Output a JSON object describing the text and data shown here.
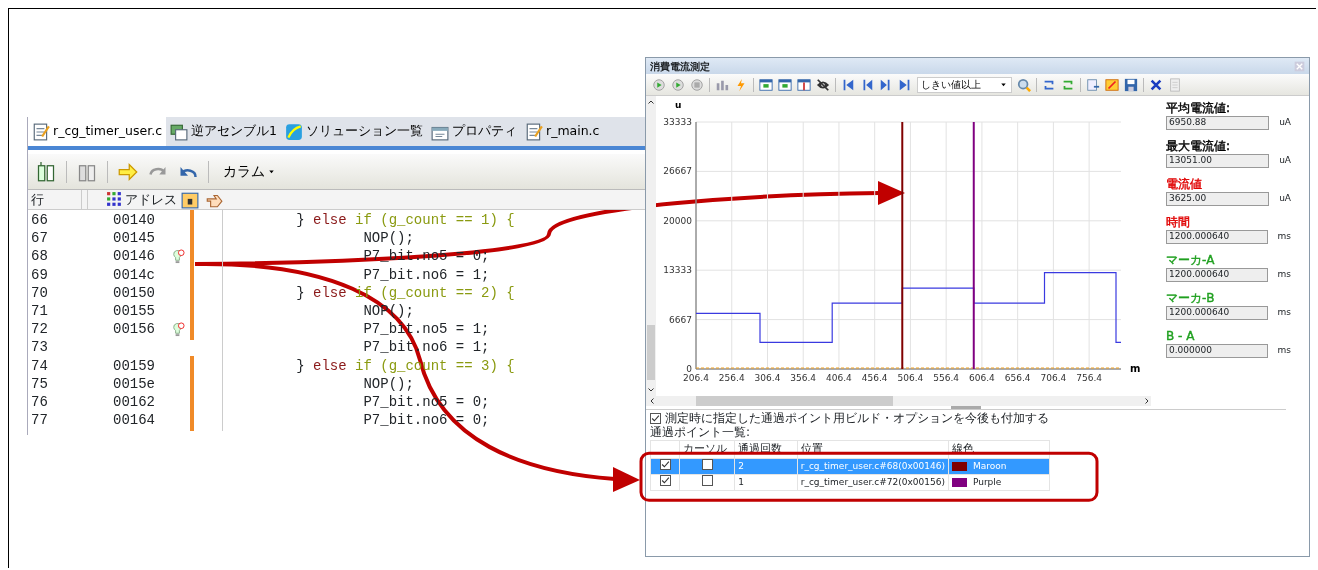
{
  "editor": {
    "tabs": [
      {
        "label": "r_cg_timer_user.c",
        "kind": "source",
        "selected": true
      },
      {
        "label": "逆アセンブル1",
        "kind": "disassembly",
        "selected": false
      },
      {
        "label": "ソリューション一覧",
        "kind": "solution",
        "selected": false
      },
      {
        "label": "プロパティ",
        "kind": "property",
        "selected": false
      },
      {
        "label": "r_main.c",
        "kind": "source",
        "selected": false
      }
    ],
    "column_menu": "カラム",
    "headers": [
      "行",
      "アドレス"
    ],
    "rows": [
      {
        "line": "66",
        "address": "00140",
        "passpoint": false,
        "executed": true,
        "code": [
          {
            "text": "        } ",
            "kind": "plain"
          },
          {
            "text": "else",
            "kind": "keyword"
          },
          {
            "text": " if (g_count == 1) {",
            "kind": "condition"
          }
        ]
      },
      {
        "line": "67",
        "address": "00145",
        "passpoint": false,
        "executed": true,
        "code": [
          {
            "text": "                NOP();",
            "kind": "plain"
          }
        ]
      },
      {
        "line": "68",
        "address": "00146",
        "passpoint": true,
        "executed": true,
        "code": [
          {
            "text": "                P7_bit.no5 = 0;",
            "kind": "plain"
          }
        ]
      },
      {
        "line": "69",
        "address": "0014c",
        "passpoint": false,
        "executed": true,
        "code": [
          {
            "text": "                P7_bit.no6 = 1;",
            "kind": "plain"
          }
        ]
      },
      {
        "line": "70",
        "address": "00150",
        "passpoint": false,
        "executed": true,
        "code": [
          {
            "text": "        } ",
            "kind": "plain"
          },
          {
            "text": "else",
            "kind": "keyword"
          },
          {
            "text": " if (g_count == 2) {",
            "kind": "condition"
          }
        ]
      },
      {
        "line": "71",
        "address": "00155",
        "passpoint": false,
        "executed": true,
        "code": [
          {
            "text": "                NOP();",
            "kind": "plain"
          }
        ]
      },
      {
        "line": "72",
        "address": "00156",
        "passpoint": true,
        "executed": true,
        "code": [
          {
            "text": "                P7_bit.no5 = 1;",
            "kind": "plain"
          }
        ]
      },
      {
        "line": "73",
        "passpoint": false,
        "executed": false,
        "code": [
          {
            "text": "                P7_bit.no6 = 1;",
            "kind": "plain"
          }
        ]
      },
      {
        "line": "74",
        "address": "00159",
        "passpoint": false,
        "executed": true,
        "code": [
          {
            "text": "        } ",
            "kind": "plain"
          },
          {
            "text": "else",
            "kind": "keyword"
          },
          {
            "text": " if (g_count == 3) {",
            "kind": "condition"
          }
        ]
      },
      {
        "line": "75",
        "address": "0015e",
        "passpoint": false,
        "executed": true,
        "code": [
          {
            "text": "                NOP();",
            "kind": "plain"
          }
        ]
      },
      {
        "line": "76",
        "address": "00162",
        "passpoint": false,
        "executed": true,
        "code": [
          {
            "text": "                P7_bit.no5 = 0;",
            "kind": "plain"
          }
        ]
      },
      {
        "line": "77",
        "address": "00164",
        "passpoint": false,
        "executed": true,
        "code": [
          {
            "text": "                P7_bit.no6 = 0;",
            "kind": "plain"
          }
        ]
      }
    ]
  },
  "window": {
    "title": "消費電流測定",
    "threshold_dropdown": "しきい値以上",
    "chart_data": {
      "type": "line",
      "xlabel": "m",
      "ylabel": "u",
      "x": [
        206.4,
        296,
        296,
        397,
        397,
        495,
        495,
        595,
        595,
        694,
        694,
        794,
        794,
        801
      ],
      "values": [
        7500,
        7500,
        3600,
        3600,
        8900,
        8900,
        10900,
        10900,
        8900,
        8900,
        13000,
        13000,
        3600,
        3600
      ],
      "xlim": [
        206.4,
        801
      ],
      "ylim": [
        0,
        33333
      ],
      "xticks": [
        206.4,
        256.4,
        306.4,
        356.4,
        406.4,
        456.4,
        506.4,
        556.4,
        606.4,
        656.4,
        706.4,
        756.4
      ],
      "yticks": [
        0,
        6667,
        13333,
        20000,
        26667,
        33333
      ],
      "grid": true,
      "ref_lines": [
        {
          "axis": "x",
          "value": 495,
          "color": "#800000"
        },
        {
          "axis": "x",
          "value": 595,
          "color": "#800080"
        }
      ]
    },
    "readouts": [
      {
        "label": "平均電流値:",
        "value": "6950.88",
        "unit": "uA",
        "color": "#000000"
      },
      {
        "label": "最大電流値:",
        "value": "13051.00",
        "unit": "uA",
        "color": "#000000"
      },
      {
        "label": "電流値",
        "value": "3625.00",
        "unit": "uA",
        "color": "#e00000"
      },
      {
        "label": "時間",
        "value": "1200.000640",
        "unit": "ms",
        "color": "#e00000"
      },
      {
        "label": "マーカ-A",
        "value": "1200.000640",
        "unit": "ms",
        "color": "#20a020"
      },
      {
        "label": "マーカ-B",
        "value": "1200.000640",
        "unit": "ms",
        "color": "#20a020"
      },
      {
        "label": "B - A",
        "value": "0.000000",
        "unit": "ms",
        "color": "#20a020"
      }
    ],
    "option": {
      "label": "測定時に指定した通過ポイント用ビルド・オプションを今後も付加する",
      "checked": true
    },
    "list_label": "通過ポイント一覧:",
    "table": {
      "columns": [
        "カーソル",
        "通過回数",
        "位置",
        "線色"
      ],
      "rows": [
        {
          "enabled": true,
          "cursor": false,
          "count": "2",
          "position": "r_cg_timer_user.c#68(0x00146)",
          "color": "#800000",
          "color_name": "Maroon",
          "selected": true
        },
        {
          "enabled": true,
          "cursor": false,
          "count": "1",
          "position": "r_cg_timer_user.c#72(0x00156)",
          "color": "#800080",
          "color_name": "Purple",
          "selected": false
        }
      ]
    }
  }
}
